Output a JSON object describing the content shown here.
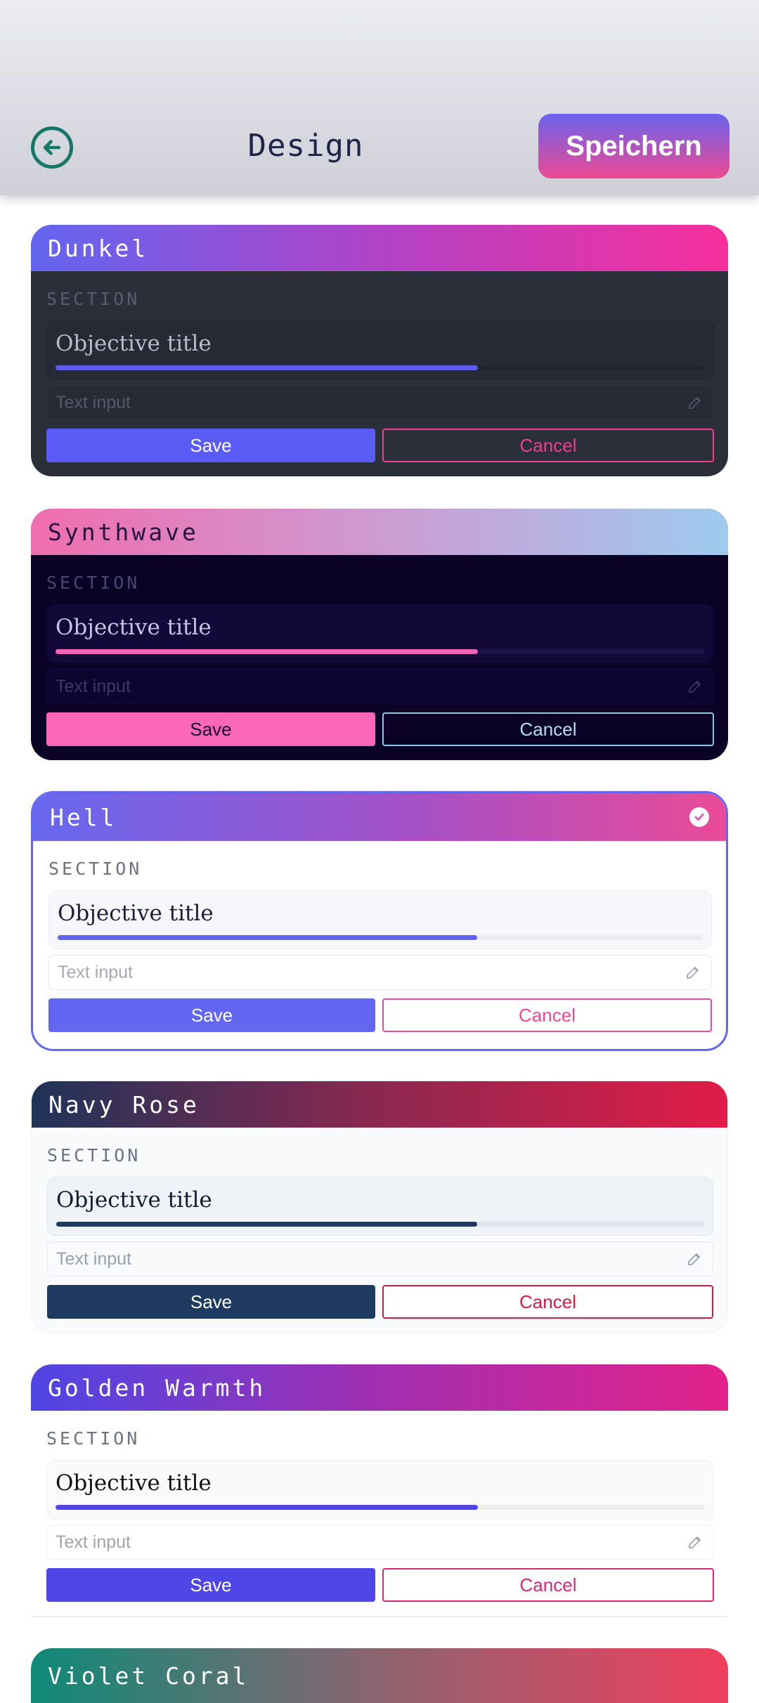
{
  "header": {
    "title": "Design",
    "save_label": "Speichern"
  },
  "colors": {
    "accent": "#6366f1",
    "brand_pink": "#ec4899",
    "back_icon": "#17786a"
  },
  "themes": [
    {
      "name": "Dunkel",
      "selected": false,
      "section_label": "SECTION",
      "objective_title": "Objective title",
      "progress": 0.65,
      "input_placeholder": "Text input",
      "save_label": "Save",
      "cancel_label": "Cancel"
    },
    {
      "name": "Synthwave",
      "selected": false,
      "section_label": "SECTION",
      "objective_title": "Objective title",
      "progress": 0.65,
      "input_placeholder": "Text input",
      "save_label": "Save",
      "cancel_label": "Cancel"
    },
    {
      "name": "Hell",
      "selected": true,
      "section_label": "SECTION",
      "objective_title": "Objective title",
      "progress": 0.65,
      "input_placeholder": "Text input",
      "save_label": "Save",
      "cancel_label": "Cancel"
    },
    {
      "name": "Navy Rose",
      "selected": false,
      "section_label": "SECTION",
      "objective_title": "Objective title",
      "progress": 0.65,
      "input_placeholder": "Text input",
      "save_label": "Save",
      "cancel_label": "Cancel"
    },
    {
      "name": "Golden Warmth",
      "selected": false,
      "section_label": "SECTION",
      "objective_title": "Objective title",
      "progress": 0.65,
      "input_placeholder": "Text input",
      "save_label": "Save",
      "cancel_label": "Cancel"
    },
    {
      "name": "Violet Coral",
      "selected": false
    }
  ]
}
